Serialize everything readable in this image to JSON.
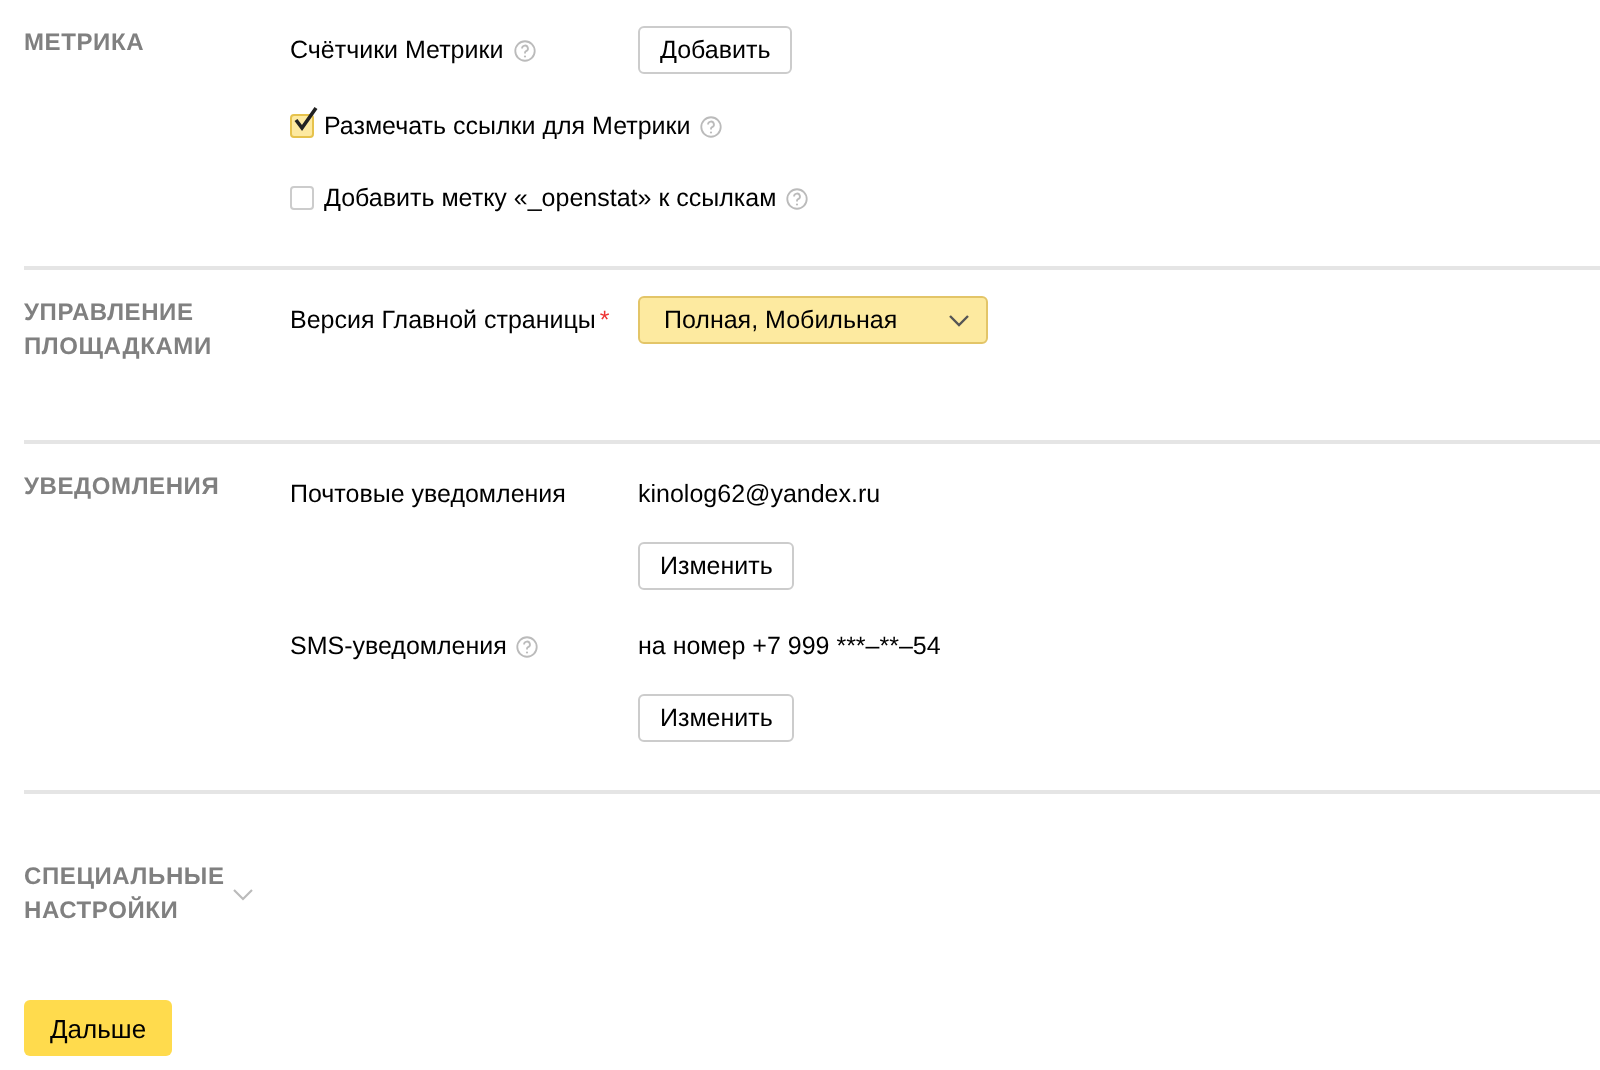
{
  "sections": [
    {
      "title": "МЕТРИКА",
      "rows": [
        {
          "kind": "button",
          "label": "Счётчики Метрики",
          "help": true,
          "button": "Добавить"
        },
        {
          "kind": "checkbox",
          "label": "Размечать ссылки для Метрики",
          "checked": true,
          "help": true
        },
        {
          "kind": "checkbox",
          "label": "Добавить метку «_openstat» к ссылкам",
          "checked": false,
          "help": true
        }
      ]
    },
    {
      "title": "УПРАВЛЕНИЕ ПЛОЩАДКАМИ",
      "rows": [
        {
          "kind": "select",
          "label": "Версия Главной страницы",
          "required_mark": "*",
          "value": "Полная, Мобильная"
        }
      ]
    },
    {
      "title": "УВЕДОМЛЕНИЯ",
      "rows": [
        {
          "kind": "contact",
          "label": "Почтовые уведомления",
          "help": false,
          "value": "kinolog62@yandex.ru",
          "button": "Изменить"
        },
        {
          "kind": "contact",
          "label": "SMS-уведомления",
          "help": true,
          "value": "на номер +7 999 ***–**–54",
          "button": "Изменить"
        }
      ]
    }
  ],
  "special": {
    "title": "СПЕЦИАЛЬНЫЕ НАСТРОЙКИ",
    "expanded": false
  },
  "next_button": "Дальше"
}
